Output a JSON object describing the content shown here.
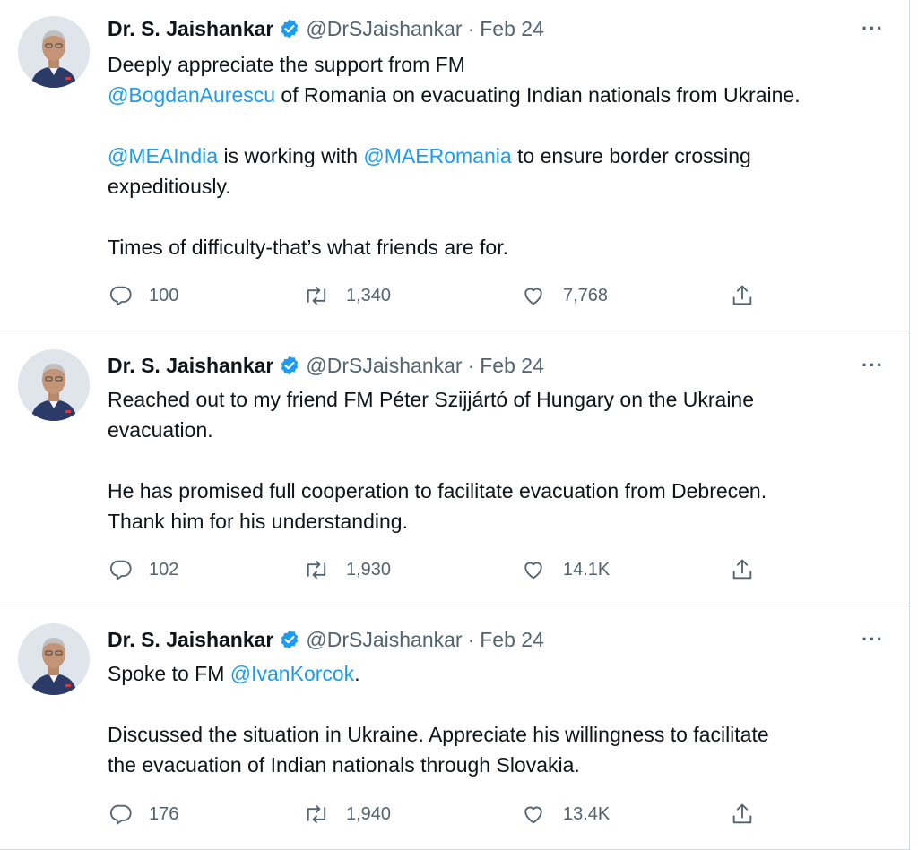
{
  "author": {
    "name": "Dr. S. Jaishankar",
    "handle": "@DrSJaishankar",
    "separator": "·"
  },
  "colors": {
    "mention": "#1d9bf0",
    "verified": "#1d9bf0",
    "muted": "#536471",
    "divider": "#cfd9de"
  },
  "more_label": "···",
  "tweets": [
    {
      "date": "Feb 24",
      "paragraphs": [
        {
          "lines": [
            [
              {
                "t": "Deeply appreciate the support from FM"
              }
            ],
            [
              {
                "t": "@BogdanAurescu",
                "m": true
              },
              {
                "t": " of Romania on evacuating Indian nationals from Ukraine."
              }
            ]
          ]
        },
        {
          "lines": [
            [
              {
                "t": "@MEAIndia",
                "m": true
              },
              {
                "t": " is working with "
              },
              {
                "t": "@MAERomania",
                "m": true
              },
              {
                "t": " to ensure border crossing"
              }
            ],
            [
              {
                "t": "expeditiously."
              }
            ]
          ]
        },
        {
          "lines": [
            [
              {
                "t": "Times of difficulty-that’s what friends are for."
              }
            ]
          ]
        }
      ],
      "replies": "100",
      "retweets": "1,340",
      "likes": "7,768"
    },
    {
      "date": "Feb 24",
      "paragraphs": [
        {
          "lines": [
            [
              {
                "t": "Reached out to my friend FM Péter Szijjártó of Hungary on the Ukraine"
              }
            ],
            [
              {
                "t": "evacuation."
              }
            ]
          ]
        },
        {
          "lines": [
            [
              {
                "t": "He has promised full cooperation to facilitate evacuation from Debrecen."
              }
            ],
            [
              {
                "t": "Thank him for his understanding."
              }
            ]
          ]
        }
      ],
      "replies": "102",
      "retweets": "1,930",
      "likes": "14.1K"
    },
    {
      "date": "Feb 24",
      "paragraphs": [
        {
          "lines": [
            [
              {
                "t": "Spoke to FM "
              },
              {
                "t": "@IvanKorcok",
                "m": true
              },
              {
                "t": "."
              }
            ]
          ]
        },
        {
          "lines": [
            [
              {
                "t": "Discussed the situation in Ukraine. Appreciate his willingness to facilitate"
              }
            ],
            [
              {
                "t": "the evacuation of Indian nationals through Slovakia."
              }
            ]
          ]
        }
      ],
      "replies": "176",
      "retweets": "1,940",
      "likes": "13.4K"
    }
  ],
  "icons": {
    "reply": "reply-icon",
    "retweet": "retweet-icon",
    "like": "like-icon",
    "share": "share-icon",
    "verified": "verified-badge-icon",
    "more": "more-options-icon"
  }
}
